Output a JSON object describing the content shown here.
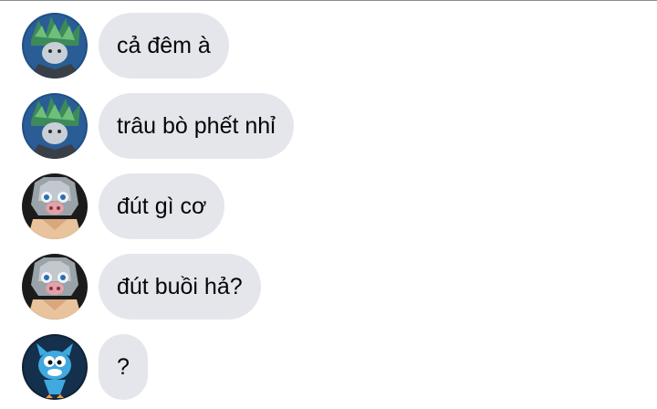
{
  "messages": [
    {
      "avatar": "green-hair-anime-avatar",
      "text": "cả đêm à"
    },
    {
      "avatar": "green-hair-anime-avatar",
      "text": "trâu bò phết nhỉ"
    },
    {
      "avatar": "boar-mask-avatar",
      "text": "đút gì cơ"
    },
    {
      "avatar": "boar-mask-avatar",
      "text": "đút buồi hả?"
    },
    {
      "avatar": "blue-cat-cartoon-avatar",
      "text": "?"
    }
  ],
  "colors": {
    "bubble": "#e4e6eb",
    "text": "#050505",
    "background": "#ffffff"
  }
}
